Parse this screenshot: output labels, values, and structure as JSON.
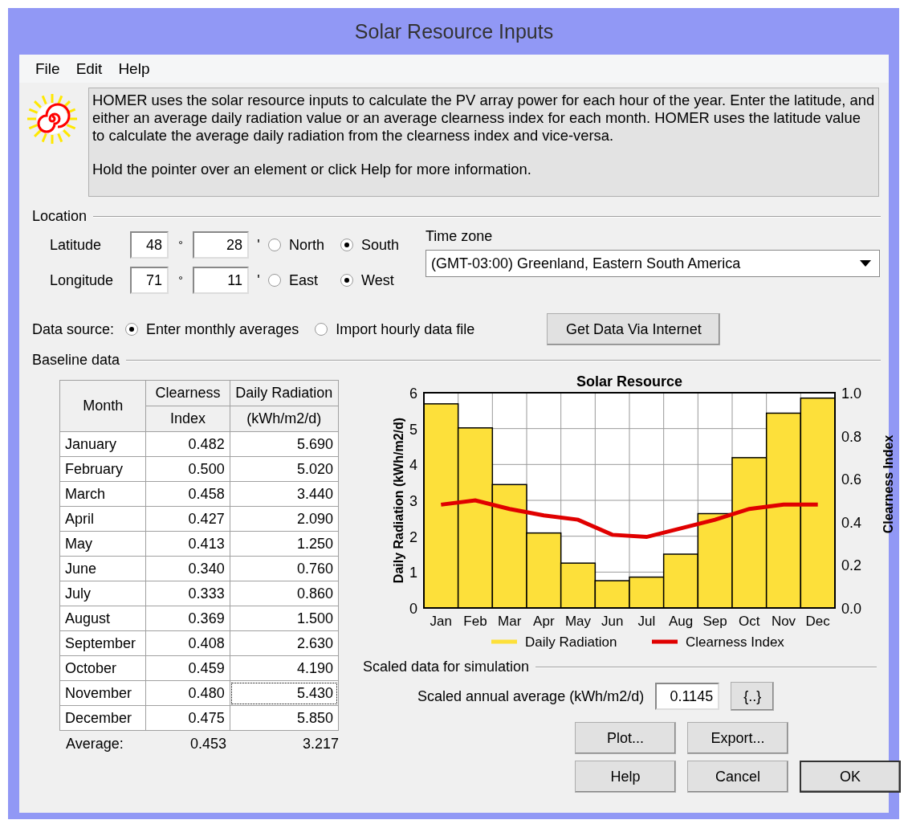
{
  "window": {
    "title": "Solar Resource Inputs"
  },
  "menu": [
    "File",
    "Edit",
    "Help"
  ],
  "info": {
    "paragraphs": [
      "HOMER uses the solar resource inputs to calculate the PV array power for each hour of the year. Enter the latitude, and either an average daily radiation value or an average clearness index for each month. HOMER uses the latitude value to calculate the average daily radiation from the clearness index and vice-versa.",
      "Hold the pointer over an element or click Help for more information."
    ]
  },
  "location": {
    "title": "Location",
    "rows": [
      {
        "label": "Latitude",
        "degrees": "48",
        "degree_mark": "°",
        "minutes": "28",
        "minute_mark": "'",
        "options": [
          {
            "label": "North",
            "selected": false
          },
          {
            "label": "South",
            "selected": true
          }
        ]
      },
      {
        "label": "Longitude",
        "degrees": "71",
        "degree_mark": "°",
        "minutes": "11",
        "minute_mark": "'",
        "options": [
          {
            "label": "East",
            "selected": false
          },
          {
            "label": "West",
            "selected": true
          }
        ]
      }
    ],
    "time_zone": {
      "label": "Time zone",
      "value": "(GMT-03:00) Greenland, Eastern South America"
    }
  },
  "data_source": {
    "label": "Data source:",
    "options": [
      {
        "label": "Enter monthly averages",
        "selected": true
      },
      {
        "label": "Import hourly data file",
        "selected": false
      }
    ],
    "button": "Get Data Via Internet"
  },
  "baseline": {
    "title": "Baseline data",
    "table": {
      "columns": [
        {
          "lines": [
            "Month"
          ]
        },
        {
          "lines": [
            "Clearness",
            "Index"
          ]
        },
        {
          "lines": [
            "Daily Radiation",
            "(kWh/m2/d)"
          ]
        }
      ],
      "rows": [
        {
          "month": "January",
          "clearness": "0.482",
          "radiation": "5.690",
          "focused": false
        },
        {
          "month": "February",
          "clearness": "0.500",
          "radiation": "5.020",
          "focused": false
        },
        {
          "month": "March",
          "clearness": "0.458",
          "radiation": "3.440",
          "focused": false
        },
        {
          "month": "April",
          "clearness": "0.427",
          "radiation": "2.090",
          "focused": false
        },
        {
          "month": "May",
          "clearness": "0.413",
          "radiation": "1.250",
          "focused": false
        },
        {
          "month": "June",
          "clearness": "0.340",
          "radiation": "0.760",
          "focused": false
        },
        {
          "month": "July",
          "clearness": "0.333",
          "radiation": "0.860",
          "focused": false
        },
        {
          "month": "August",
          "clearness": "0.369",
          "radiation": "1.500",
          "focused": false
        },
        {
          "month": "September",
          "clearness": "0.408",
          "radiation": "2.630",
          "focused": false
        },
        {
          "month": "October",
          "clearness": "0.459",
          "radiation": "4.190",
          "focused": false
        },
        {
          "month": "November",
          "clearness": "0.480",
          "radiation": "5.430",
          "focused": true
        },
        {
          "month": "December",
          "clearness": "0.475",
          "radiation": "5.850",
          "focused": false
        }
      ],
      "average": {
        "label": "Average:",
        "clearness": "0.453",
        "radiation": "3.217"
      }
    },
    "chart_data": {
      "type": "bar",
      "title": "Solar Resource",
      "ylabel": "Daily Radiation (kWh/m2/d)",
      "y2label": "Clearness Index",
      "categories": [
        "Jan",
        "Feb",
        "Mar",
        "Apr",
        "May",
        "Jun",
        "Jul",
        "Aug",
        "Sep",
        "Oct",
        "Nov",
        "Dec"
      ],
      "series": [
        {
          "name": "Daily Radiation",
          "color": "#fde03a",
          "type": "bar",
          "values": [
            5.69,
            5.02,
            3.44,
            2.09,
            1.25,
            0.76,
            0.86,
            1.5,
            2.63,
            4.19,
            5.43,
            5.85
          ]
        },
        {
          "name": "Clearness Index",
          "color": "#e00000",
          "type": "line",
          "axis": "y2",
          "values": [
            0.48,
            0.5,
            0.46,
            0.43,
            0.41,
            0.34,
            0.33,
            0.37,
            0.41,
            0.46,
            0.48,
            0.48
          ]
        }
      ],
      "grid": true,
      "ylim": [
        0,
        6
      ],
      "yticks": [
        0,
        1,
        2,
        3,
        4,
        5,
        6
      ],
      "y2lim": [
        0,
        1
      ],
      "y2ticks": [
        {
          "value": 0,
          "label": "0.0"
        },
        {
          "value": 0.2,
          "label": "0.2"
        },
        {
          "value": 0.4,
          "label": "0.4"
        },
        {
          "value": 0.6,
          "label": "0.6"
        },
        {
          "value": 0.8,
          "label": "0.8"
        },
        {
          "value": 1,
          "label": "1.0"
        }
      ]
    }
  },
  "scaled": {
    "title": "Scaled data for simulation",
    "label": "Scaled annual average (kWh/m2/d)",
    "value": "0.1145",
    "button": "{..}"
  },
  "buttons": [
    {
      "label": "Plot...",
      "default": false
    },
    {
      "label": "Export...",
      "default": false
    },
    {
      "label": "Help",
      "default": false
    },
    {
      "label": "Cancel",
      "default": false
    },
    {
      "label": "OK",
      "default": true
    }
  ]
}
